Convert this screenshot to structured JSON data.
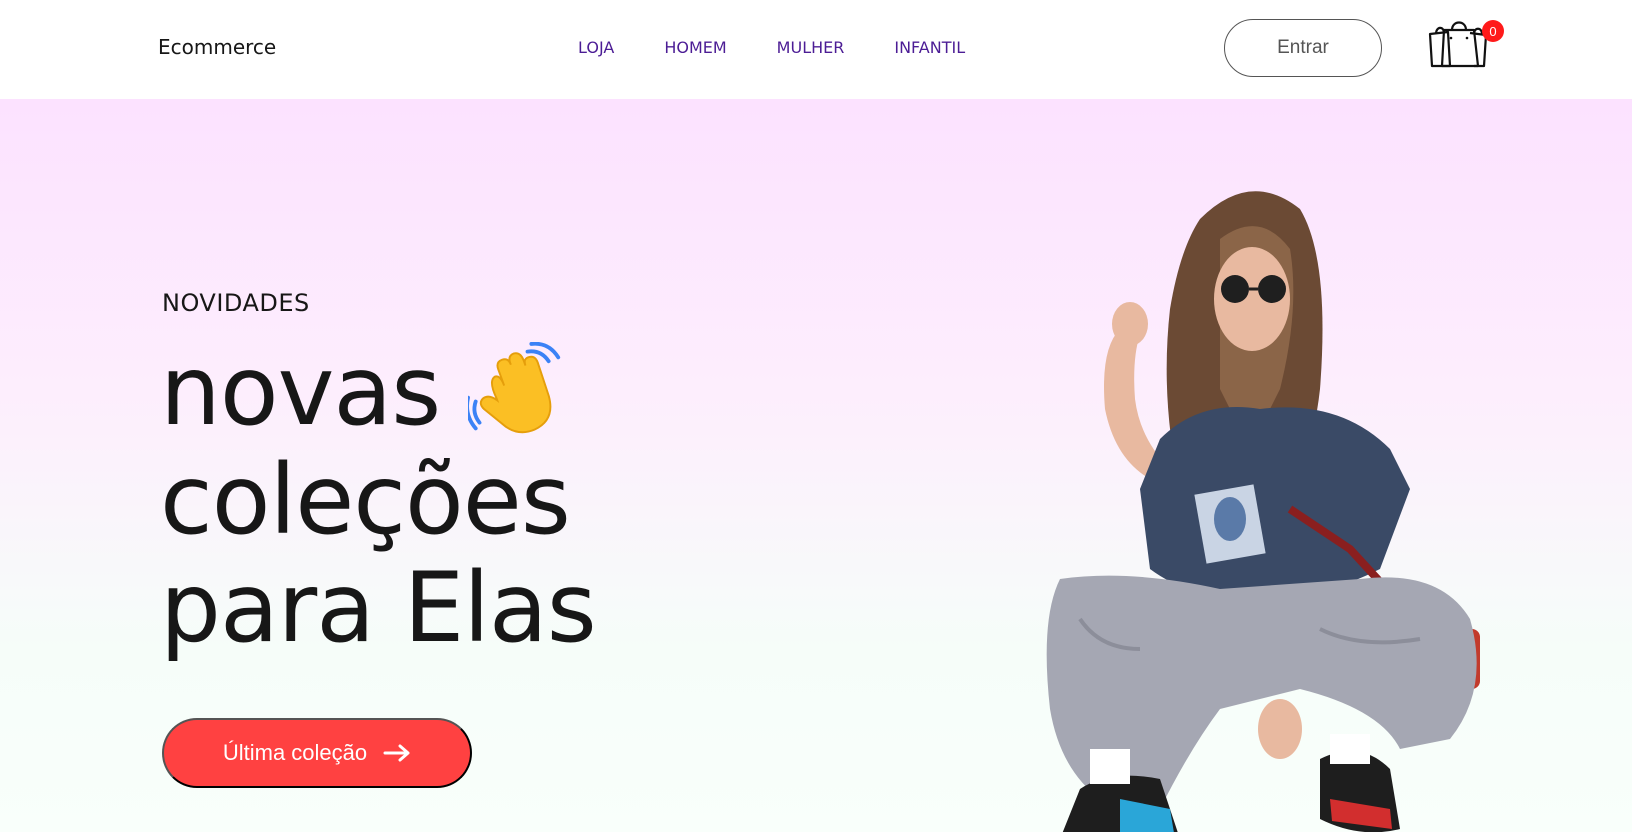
{
  "header": {
    "logo": "Ecommerce",
    "menu": [
      {
        "label": "LOJA"
      },
      {
        "label": "HOMEM"
      },
      {
        "label": "MULHER"
      },
      {
        "label": "INFANTIL"
      }
    ],
    "login_label": "Entrar",
    "cart_count": "0"
  },
  "hero": {
    "tag": "NOVIDADES",
    "title_line1": "novas",
    "title_line2": "coleções",
    "title_line3": "para Elas",
    "cta_label": "Última coleção"
  },
  "colors": {
    "accent": "#ff4141",
    "menu": "#4c1d95",
    "badge": "#ff1a1a"
  },
  "icons": {
    "cart": "shopping-bags-icon",
    "wave": "waving-hand-icon",
    "arrow": "arrow-right-icon"
  }
}
